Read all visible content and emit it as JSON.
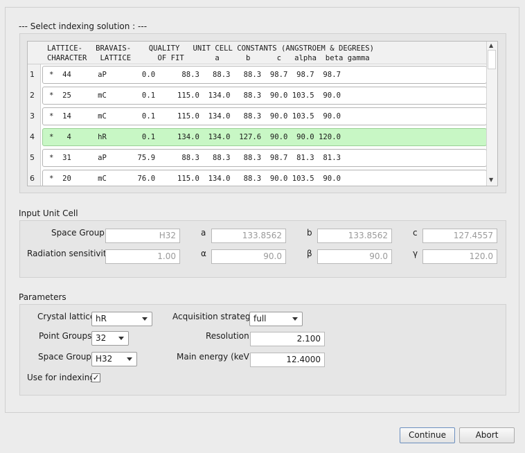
{
  "section_indexing": {
    "title": "--- Select indexing solution : ---"
  },
  "table": {
    "header_line1": "LATTICE-   BRAVAIS-    QUALITY   UNIT CELL CONSTANTS (ANGSTROEM & DEGREES)",
    "header_line2": "CHARACTER   LATTICE      OF FIT       a      b      c   alpha  beta gamma",
    "rows": [
      {
        "num": "1",
        "text": "*  44      aP        0.0      88.3   88.3   88.3  98.7  98.7  98.7"
      },
      {
        "num": "2",
        "text": "*  25      mC        0.1     115.0  134.0   88.3  90.0 103.5  90.0"
      },
      {
        "num": "3",
        "text": "*  14      mC        0.1     115.0  134.0   88.3  90.0 103.5  90.0"
      },
      {
        "num": "4",
        "text": "*   4      hR        0.1     134.0  134.0  127.6  90.0  90.0 120.0"
      },
      {
        "num": "5",
        "text": "*  31      aP       75.9      88.3   88.3   88.3  98.7  81.3  81.3"
      },
      {
        "num": "6",
        "text": "*  20      mC       76.0     115.0  134.0   88.3  90.0 103.5  90.0"
      }
    ],
    "selected_row": "4",
    "selected_color": "#c8f7c5"
  },
  "input_cell": {
    "title": "Input Unit Cell",
    "space_group_label": "Space Group",
    "space_group_value": "H32",
    "a_label": "a",
    "a_value": "133.8562",
    "b_label": "b",
    "b_value": "133.8562",
    "c_label": "c",
    "c_value": "127.4557",
    "radiation_label": "Radiation sensitivity",
    "radiation_value": "1.00",
    "alpha_label": "α",
    "alpha_value": "90.0",
    "beta_label": "β",
    "beta_value": "90.0",
    "gamma_label": "γ",
    "gamma_value": "120.0"
  },
  "parameters": {
    "title": "Parameters",
    "crystal_lattice_label": "Crystal lattice",
    "crystal_lattice_value": "hR",
    "point_groups_label": "Point Groups",
    "point_groups_value": "32",
    "space_group_label": "Space Group",
    "space_group_value": "H32",
    "use_for_indexing_label": "Use for indexing",
    "use_for_indexing_checked": "✓",
    "acquisition_label": "Acquisition strategy",
    "acquisition_value": "full",
    "resolution_label": "Resolution",
    "resolution_value": "2.100",
    "energy_label": "Main energy (keV)",
    "energy_value": "12.4000"
  },
  "buttons": {
    "continue": "Continue",
    "abort": "Abort"
  }
}
